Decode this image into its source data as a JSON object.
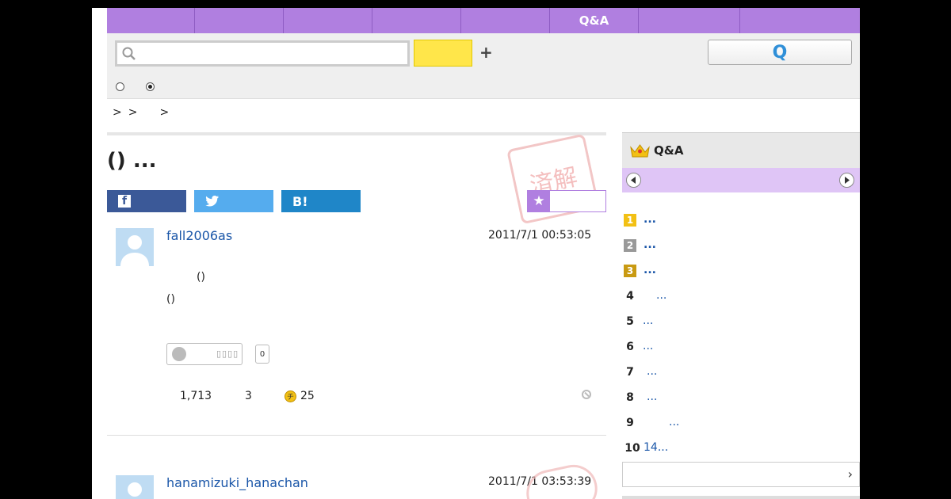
{
  "nav": {
    "tabs": [
      "",
      "",
      "",
      "",
      "",
      "Q&A",
      "",
      ""
    ]
  },
  "search": {
    "placeholder": "",
    "submit_label": "Q"
  },
  "breadcrumb": [
    ">",
    ">",
    ">"
  ],
  "question": {
    "title": "() ...",
    "stamp_text": "済解",
    "share": [
      {
        "label": "f",
        "color": "#3b5998"
      },
      {
        "label": "🐦",
        "color": "#55acee"
      },
      {
        "label": "B!",
        "color": "#1f86c8"
      }
    ],
    "author": "fall2006as",
    "datetime": "2011/7/1  00:53:05",
    "body_lines": [
      "()",
      "()"
    ],
    "reaction_count": "0",
    "views": "1,713",
    "answers": "3",
    "coins": "25"
  },
  "answer": {
    "author": "hanamizuki_hanachan",
    "datetime": "2011/7/1  03:53:39"
  },
  "ranking": {
    "title": "Q&A",
    "items": [
      {
        "rank": "1",
        "text": "...",
        "medal": "#f2c014"
      },
      {
        "rank": "2",
        "text": "...",
        "medal": "#999999"
      },
      {
        "rank": "3",
        "text": "...",
        "medal": "#c99a12"
      },
      {
        "rank": "4",
        "text": "...",
        "medal": ""
      },
      {
        "rank": "5",
        "text": "...",
        "medal": ""
      },
      {
        "rank": "6",
        "text": "...",
        "medal": ""
      },
      {
        "rank": "7",
        "text": "...",
        "medal": ""
      },
      {
        "rank": "8",
        "text": "...",
        "medal": ""
      },
      {
        "rank": "9",
        "text": "...",
        "medal": ""
      },
      {
        "rank": "10",
        "text": "14...",
        "medal": ""
      }
    ],
    "more_chevron": "›"
  },
  "colors": {
    "accent": "#b07fe0",
    "link": "#1a56a8"
  },
  "icons": [
    "search-icon",
    "plus-icon",
    "star-icon",
    "smile-icon",
    "coin-icon",
    "ban-icon",
    "crown-icon",
    "arrow-left-icon",
    "arrow-right-icon",
    "chevron-right-icon"
  ]
}
